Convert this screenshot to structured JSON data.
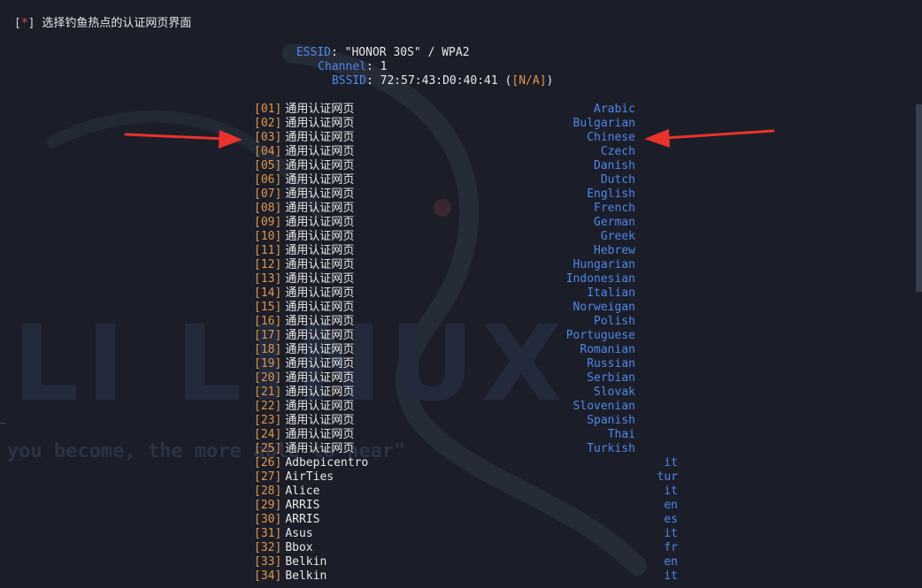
{
  "watermark": {
    "title": "LI LINUX",
    "subtitle": "you become, the more able to hear\""
  },
  "prompt": {
    "marker": "*",
    "title": "选择钓鱼热点的认证网页界面"
  },
  "network": {
    "essid_label": "ESSID",
    "essid_value": "\"HONOR 30S\" / WPA2",
    "channel_label": "Channel",
    "channel_value": "1",
    "bssid_label": "BSSID",
    "bssid_value": "72:57:43:D0:40:41",
    "bssid_status": "N/A"
  },
  "portals": [
    {
      "index": "01",
      "name": "通用认证网页",
      "lang": "Arabic"
    },
    {
      "index": "02",
      "name": "通用认证网页",
      "lang": "Bulgarian"
    },
    {
      "index": "03",
      "name": "通用认证网页",
      "lang": "Chinese"
    },
    {
      "index": "04",
      "name": "通用认证网页",
      "lang": "Czech"
    },
    {
      "index": "05",
      "name": "通用认证网页",
      "lang": "Danish"
    },
    {
      "index": "06",
      "name": "通用认证网页",
      "lang": "Dutch"
    },
    {
      "index": "07",
      "name": "通用认证网页",
      "lang": "English"
    },
    {
      "index": "08",
      "name": "通用认证网页",
      "lang": "French"
    },
    {
      "index": "09",
      "name": "通用认证网页",
      "lang": "German"
    },
    {
      "index": "10",
      "name": "通用认证网页",
      "lang": "Greek"
    },
    {
      "index": "11",
      "name": "通用认证网页",
      "lang": "Hebrew"
    },
    {
      "index": "12",
      "name": "通用认证网页",
      "lang": "Hungarian"
    },
    {
      "index": "13",
      "name": "通用认证网页",
      "lang": "Indonesian"
    },
    {
      "index": "14",
      "name": "通用认证网页",
      "lang": "Italian"
    },
    {
      "index": "15",
      "name": "通用认证网页",
      "lang": "Norweigan"
    },
    {
      "index": "16",
      "name": "通用认证网页",
      "lang": "Polish"
    },
    {
      "index": "17",
      "name": "通用认证网页",
      "lang": "Portuguese"
    },
    {
      "index": "18",
      "name": "通用认证网页",
      "lang": "Romanian"
    },
    {
      "index": "19",
      "name": "通用认证网页",
      "lang": "Russian"
    },
    {
      "index": "20",
      "name": "通用认证网页",
      "lang": "Serbian"
    },
    {
      "index": "21",
      "name": "通用认证网页",
      "lang": "Slovak"
    },
    {
      "index": "22",
      "name": "通用认证网页",
      "lang": "Slovenian"
    },
    {
      "index": "23",
      "name": "通用认证网页",
      "lang": "Spanish"
    },
    {
      "index": "24",
      "name": "通用认证网页",
      "lang": "Thai"
    },
    {
      "index": "25",
      "name": "通用认证网页",
      "lang": "Turkish"
    },
    {
      "index": "26",
      "name": "Adbepicentro",
      "lang": "it"
    },
    {
      "index": "27",
      "name": "AirTies",
      "lang": "tur"
    },
    {
      "index": "28",
      "name": "Alice",
      "lang": "it"
    },
    {
      "index": "29",
      "name": "ARRIS",
      "lang": "en"
    },
    {
      "index": "30",
      "name": "ARRIS",
      "lang": "es"
    },
    {
      "index": "31",
      "name": "Asus",
      "lang": "it"
    },
    {
      "index": "32",
      "name": "Bbox",
      "lang": "fr"
    },
    {
      "index": "33",
      "name": "Belkin",
      "lang": "en"
    },
    {
      "index": "34",
      "name": "Belkin",
      "lang": "it"
    }
  ],
  "colors": {
    "background": "#1b1e29",
    "accent_blue": "#4f86e8",
    "accent_orange": "#e0954a",
    "arrow_red": "#e8322c"
  },
  "annotations": [
    {
      "points_to": "03"
    },
    {
      "points_to": "Chinese"
    }
  ]
}
